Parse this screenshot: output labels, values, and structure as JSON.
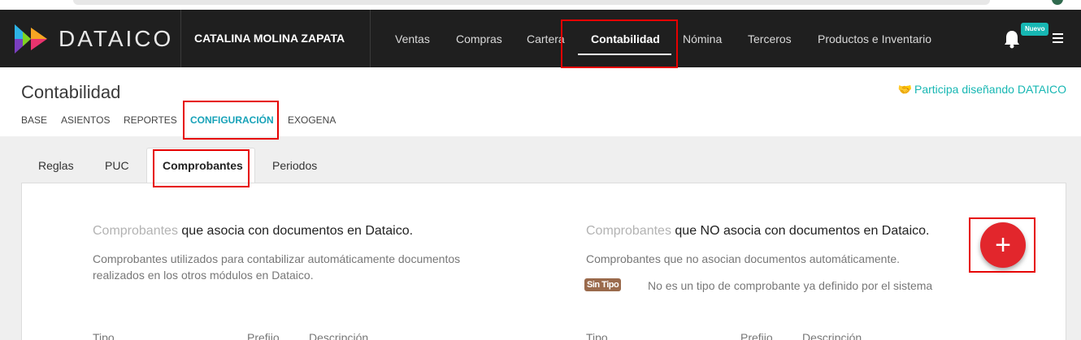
{
  "navbar": {
    "brand": "DATAICO",
    "company": "CATALINA MOLINA ZAPATA",
    "items": [
      {
        "label": "Ventas"
      },
      {
        "label": "Compras"
      },
      {
        "label": "Cartera"
      },
      {
        "label": "Contabilidad",
        "active": true
      },
      {
        "label": "Nómina"
      },
      {
        "label": "Terceros"
      },
      {
        "label": "Productos e Inventario"
      }
    ],
    "badge": "Nuevo",
    "bell_icon": "bell-icon",
    "menu_icon": "hamburger-menu-icon"
  },
  "subheader": {
    "title": "Contabilidad",
    "participa": "Participa diseñando DATAICO",
    "participa_icon": "handshake-icon",
    "items": [
      {
        "label": "BASE"
      },
      {
        "label": "ASIENTOS"
      },
      {
        "label": "REPORTES"
      },
      {
        "label": "CONFIGURACIÓN",
        "active": true
      },
      {
        "label": "EXOGENA"
      }
    ]
  },
  "tabs": [
    {
      "label": "Reglas"
    },
    {
      "label": "PUC"
    },
    {
      "label": "Comprobantes",
      "active": true
    },
    {
      "label": "Periodos"
    }
  ],
  "left_section": {
    "title_light": "Comprobantes",
    "title_bold": "que asocia con documentos en Dataico.",
    "desc_line1": "Comprobantes utilizados para contabilizar automáticamente documentos",
    "desc_line2": "realizados en los otros módulos en Dataico.",
    "columns": [
      "Tipo",
      "Prefijo",
      "Descripción"
    ]
  },
  "right_section": {
    "title_light": "Comprobantes",
    "title_bold": "que NO asocia con documentos en Dataico.",
    "desc": "Comprobantes que no asocian documentos automáticamente.",
    "badge": "Sin Tipo",
    "badge_desc": "No es un tipo de comprobante ya definido por el sistema",
    "columns": [
      "Tipo",
      "Prefijo",
      "Descripción"
    ]
  },
  "fab": {
    "label": "+",
    "icon": "plus-icon"
  },
  "colors": {
    "navbar_bg": "#1f1f1f",
    "accent": "#17a2b8",
    "fab": "#e2262c",
    "badge_sintipo": "#9a6a4c",
    "highlight": "#e60000"
  }
}
